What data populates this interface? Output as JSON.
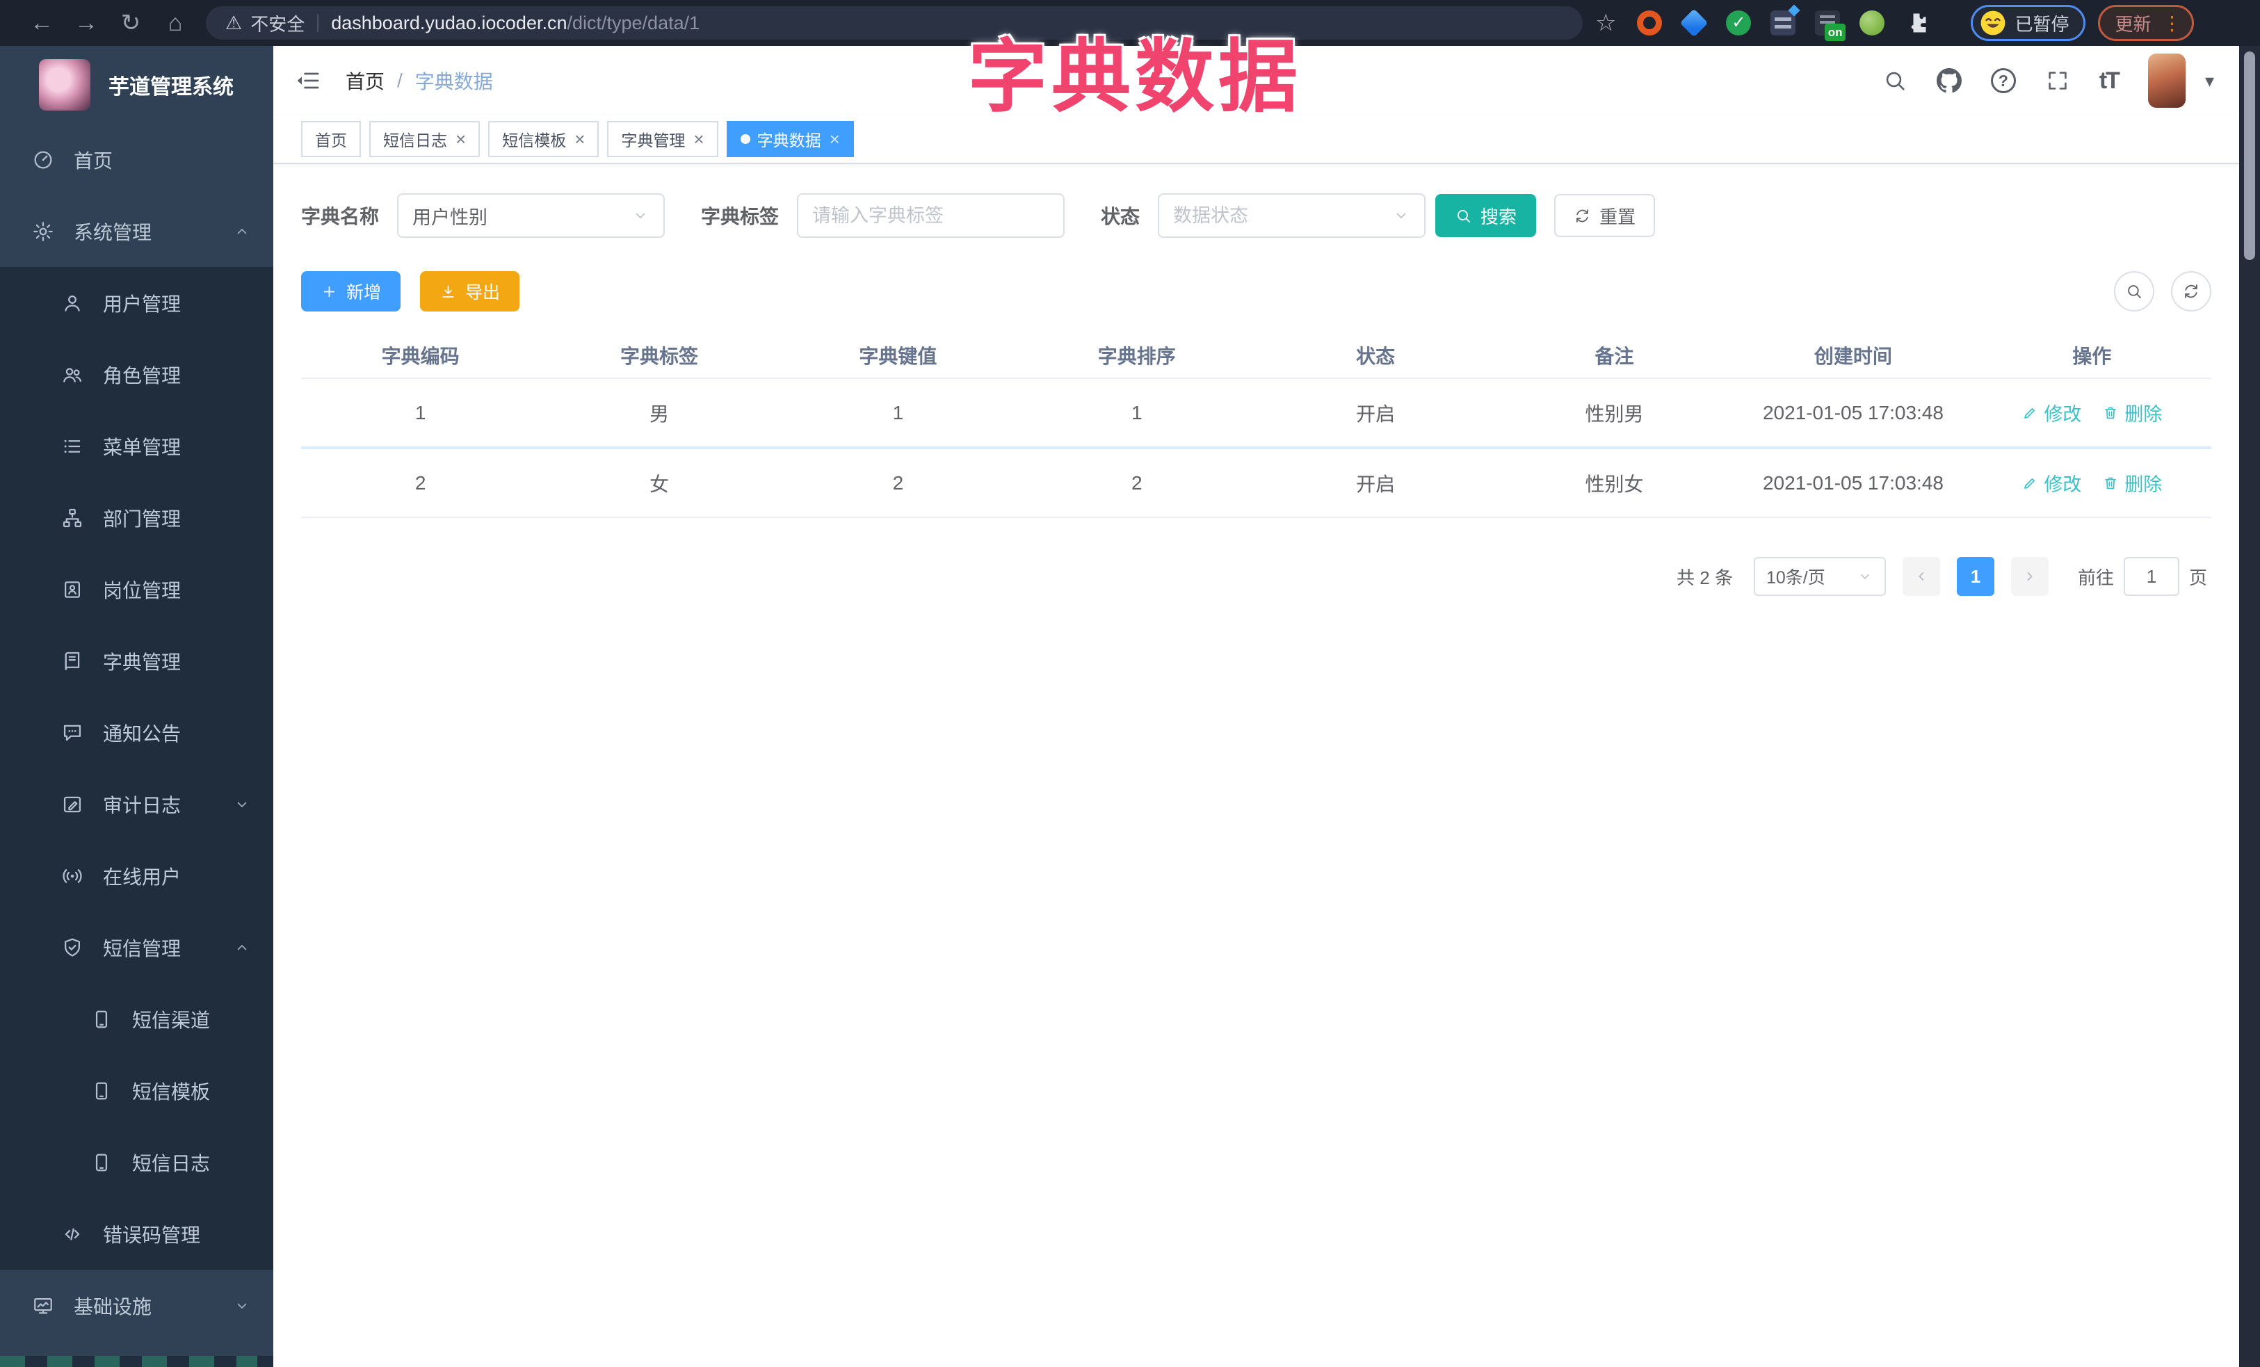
{
  "browser": {
    "security_label": "不安全",
    "url_host": "dashboard.yudao.iocoder.cn",
    "url_path": "/dict/type/data/1",
    "paused_label": "已暂停",
    "update_label": "更新",
    "on_badge": "on"
  },
  "icons": {
    "back": "←",
    "forward": "→",
    "reload": "↻",
    "home": "⌂",
    "star": "☆",
    "warning": "⚠",
    "dots": "⋮",
    "caret": "▾",
    "help": "?",
    "fontsize": "tT",
    "close": "×",
    "slash": "/"
  },
  "overlay_title": "字典数据",
  "sidebar": {
    "logo_title": "芋道管理系统",
    "menu": [
      {
        "id": "home",
        "label": "首页",
        "icon": "dashboard-icon",
        "level": 1
      },
      {
        "id": "system",
        "label": "系统管理",
        "icon": "gear-icon",
        "level": 1,
        "arrow": "up"
      },
      {
        "id": "user",
        "label": "用户管理",
        "icon": "user-icon",
        "level": 2
      },
      {
        "id": "role",
        "label": "角色管理",
        "icon": "users-icon",
        "level": 2
      },
      {
        "id": "menu",
        "label": "菜单管理",
        "icon": "menu-list-icon",
        "level": 2
      },
      {
        "id": "dept",
        "label": "部门管理",
        "icon": "org-tree-icon",
        "level": 2
      },
      {
        "id": "post",
        "label": "岗位管理",
        "icon": "id-card-icon",
        "level": 2
      },
      {
        "id": "dict",
        "label": "字典管理",
        "icon": "book-icon",
        "level": 2
      },
      {
        "id": "notice",
        "label": "通知公告",
        "icon": "message-icon",
        "level": 2
      },
      {
        "id": "audit",
        "label": "审计日志",
        "icon": "edit-log-icon",
        "level": 2,
        "arrow": "down"
      },
      {
        "id": "online",
        "label": "在线用户",
        "icon": "broadcast-icon",
        "level": 2
      },
      {
        "id": "sms",
        "label": "短信管理",
        "icon": "shield-check-icon",
        "level": 2,
        "arrow": "up"
      },
      {
        "id": "sms-channel",
        "label": "短信渠道",
        "icon": "phone-icon",
        "level": 3
      },
      {
        "id": "sms-template",
        "label": "短信模板",
        "icon": "phone-icon",
        "level": 3
      },
      {
        "id": "sms-log",
        "label": "短信日志",
        "icon": "phone-icon",
        "level": 3
      },
      {
        "id": "errcode",
        "label": "错误码管理",
        "icon": "code-icon",
        "level": 2
      },
      {
        "id": "infra",
        "label": "基础设施",
        "icon": "monitor-icon",
        "level": 1,
        "arrow": "down"
      }
    ]
  },
  "header": {
    "breadcrumb_home": "首页",
    "breadcrumb_sep": "/",
    "breadcrumb_current": "字典数据"
  },
  "tabs": [
    {
      "label": "首页",
      "closable": false,
      "active": false
    },
    {
      "label": "短信日志",
      "closable": true,
      "active": false
    },
    {
      "label": "短信模板",
      "closable": true,
      "active": false
    },
    {
      "label": "字典管理",
      "closable": true,
      "active": false
    },
    {
      "label": "字典数据",
      "closable": true,
      "active": true
    }
  ],
  "filters": {
    "name_label": "字典名称",
    "name_value": "用户性别",
    "tag_label": "字典标签",
    "tag_placeholder": "请输入字典标签",
    "status_label": "状态",
    "status_placeholder": "数据状态",
    "search_label": "搜索",
    "reset_label": "重置"
  },
  "toolbar": {
    "add_label": "新增",
    "export_label": "导出"
  },
  "table": {
    "columns": [
      "字典编码",
      "字典标签",
      "字典键值",
      "字典排序",
      "状态",
      "备注",
      "创建时间",
      "操作"
    ],
    "rows": [
      [
        "1",
        "男",
        "1",
        "1",
        "开启",
        "性别男",
        "2021-01-05 17:03:48"
      ],
      [
        "2",
        "女",
        "2",
        "2",
        "开启",
        "性别女",
        "2021-01-05 17:03:48"
      ]
    ],
    "edit_label": "修改",
    "delete_label": "删除"
  },
  "pagination": {
    "total": "共 2 条",
    "page_size": "10条/页",
    "current": "1",
    "goto_label": "前往",
    "goto_value": "1",
    "unit": "页"
  },
  "colors": {
    "accent_blue": "#409EFF",
    "theme_teal": "#17b3a3",
    "export_yellow": "#f2a713",
    "overlay_red": "#f0436e",
    "link_teal": "#3ac2c6",
    "sidebar_bg": "#304156",
    "submenu_bg": "#1f2d3d"
  }
}
